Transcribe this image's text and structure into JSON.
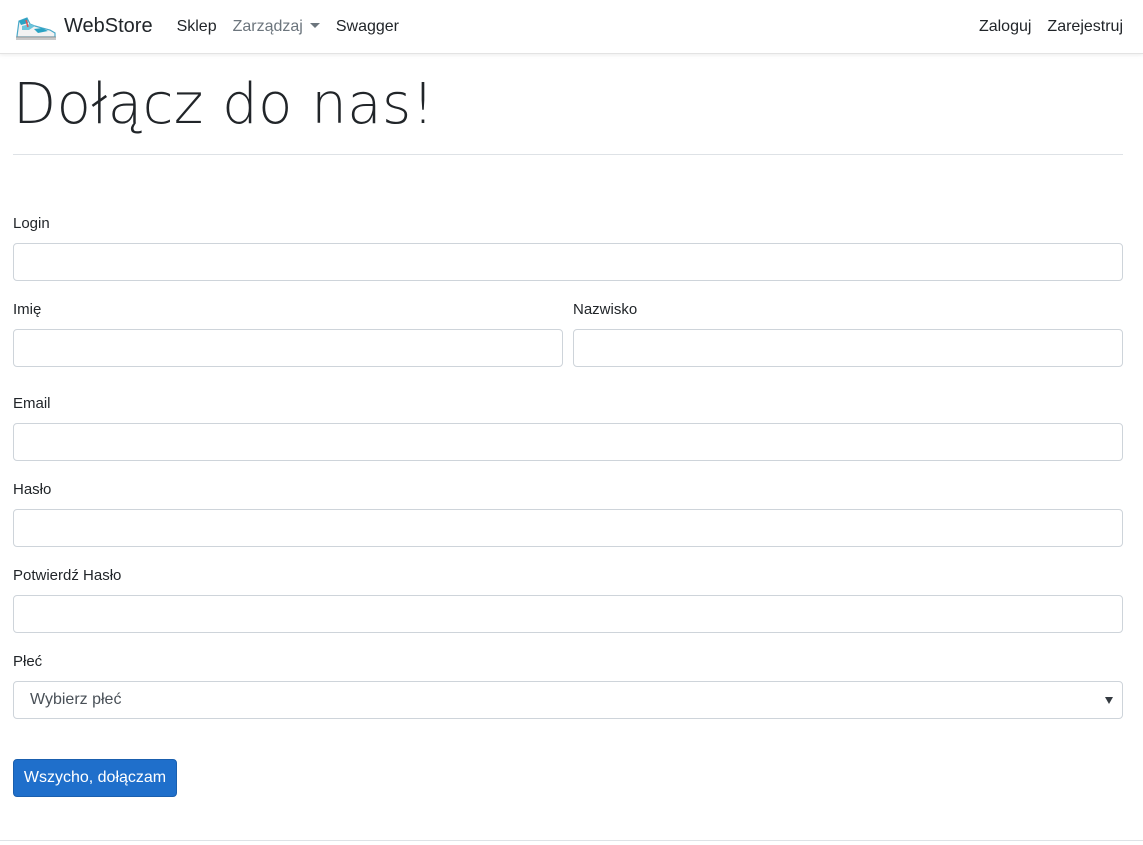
{
  "navbar": {
    "brand": "WebStore",
    "brand_logo_icon": "sneaker-logo-icon",
    "links": {
      "shop": "Sklep",
      "manage": "Zarządzaj",
      "swagger": "Swagger"
    },
    "right_links": {
      "login": "Zaloguj",
      "register": "Zarejestruj"
    }
  },
  "page": {
    "title": "Dołącz do nas!"
  },
  "form": {
    "login": {
      "label": "Login",
      "value": ""
    },
    "first_name": {
      "label": "Imię",
      "value": ""
    },
    "last_name": {
      "label": "Nazwisko",
      "value": ""
    },
    "email": {
      "label": "Email",
      "value": ""
    },
    "password": {
      "label": "Hasło",
      "value": ""
    },
    "confirm_password": {
      "label": "Potwierdź Hasło",
      "value": ""
    },
    "gender": {
      "label": "Płeć",
      "selected": "Wybierz płeć"
    },
    "submit_label": "Wszycho, dołączam"
  },
  "colors": {
    "primary": "#1f6fcb",
    "text": "#212529",
    "muted": "#6c757d",
    "border": "#ced4da"
  }
}
